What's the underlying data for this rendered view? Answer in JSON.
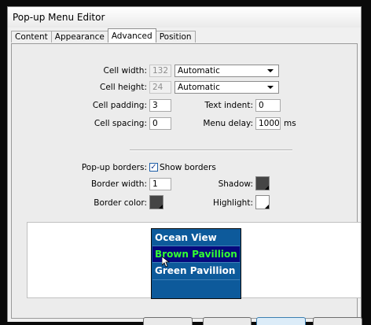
{
  "window": {
    "title": "Pop-up Menu Editor"
  },
  "tabs": [
    {
      "label": "Content",
      "active": false
    },
    {
      "label": "Appearance",
      "active": false
    },
    {
      "label": "Advanced",
      "active": true
    },
    {
      "label": "Position",
      "active": false
    }
  ],
  "cell": {
    "width_label": "Cell width:",
    "width_value": "132",
    "width_mode": "Automatic",
    "height_label": "Cell height:",
    "height_value": "24",
    "height_mode": "Automatic",
    "padding_label": "Cell padding:",
    "padding_value": "3",
    "spacing_label": "Cell spacing:",
    "spacing_value": "0",
    "indent_label": "Text indent:",
    "indent_value": "0",
    "delay_label": "Menu delay:",
    "delay_value": "1000",
    "delay_unit": "ms"
  },
  "borders": {
    "popup_label": "Pop-up borders:",
    "show_label": "Show borders",
    "show_checked": true,
    "width_label": "Border width:",
    "width_value": "1",
    "color_label": "Border color:",
    "color_value": "#454545",
    "shadow_label": "Shadow:",
    "shadow_color": "#454545",
    "highlight_label": "Highlight:",
    "highlight_color": "#ffffff"
  },
  "preview": {
    "menu_bg": "#0d5a9b",
    "highlight_bg": "#06087c",
    "text_color": "#ffffff",
    "highlight_text_color": "#33ff33",
    "items": [
      {
        "label": "Ocean View",
        "highlighted": false
      },
      {
        "label": "Brown Pavillion",
        "highlighted": true
      },
      {
        "label": "Green Pavillion",
        "highlighted": false
      }
    ]
  }
}
